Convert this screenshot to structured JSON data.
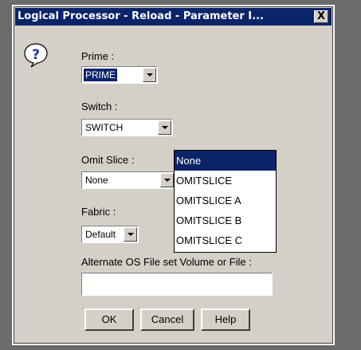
{
  "dialog": {
    "title": "Logical Processor - Reload - Parameter I...",
    "close_symbol": "X"
  },
  "icons": {
    "info": "question-icon"
  },
  "fields": {
    "prime": {
      "label": "Prime :",
      "value": "PRIME"
    },
    "switch": {
      "label": "Switch :",
      "value": "SWITCH"
    },
    "omit_slice": {
      "label": "Omit Slice :",
      "value": "None"
    },
    "fabric": {
      "label": "Fabric :",
      "value": "Default"
    },
    "alternate_os": {
      "label": "Alternate OS File set Volume or File :",
      "value": ""
    }
  },
  "omit_slice_options": [
    "None",
    "OMITSLICE",
    "OMITSLICE A",
    "OMITSLICE B",
    "OMITSLICE C"
  ],
  "omit_slice_highlighted": "None",
  "buttons": {
    "ok": "OK",
    "cancel": "Cancel",
    "help": "Help"
  },
  "colors": {
    "title_bar": "#0a246a",
    "dialog_bg": "#d4d0c8",
    "selection": "#0a246a"
  }
}
